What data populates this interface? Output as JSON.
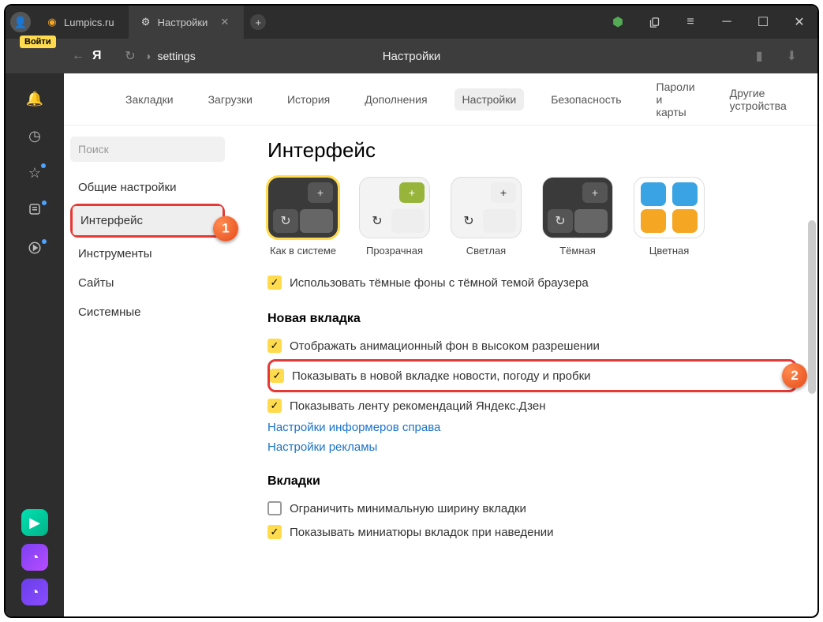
{
  "titlebar": {
    "login_badge": "Войти",
    "tabs": [
      {
        "label": "Lumpics.ru"
      },
      {
        "label": "Настройки"
      }
    ]
  },
  "addressbar": {
    "url_text": "settings",
    "center_title": "Настройки"
  },
  "topnav": {
    "items": [
      "Закладки",
      "Загрузки",
      "История",
      "Дополнения",
      "Настройки",
      "Безопасность",
      "Пароли и карты",
      "Другие устройства"
    ],
    "active_index": 4
  },
  "sidenav": {
    "search_placeholder": "Поиск",
    "items": [
      "Общие настройки",
      "Интерфейс",
      "Инструменты",
      "Сайты",
      "Системные"
    ],
    "active_index": 1
  },
  "settings": {
    "heading": "Интерфейс",
    "themes": [
      {
        "label": "Как в системе"
      },
      {
        "label": "Прозрачная"
      },
      {
        "label": "Светлая"
      },
      {
        "label": "Тёмная"
      },
      {
        "label": "Цветная"
      }
    ],
    "dark_bg_label": "Использовать тёмные фоны с тёмной темой браузера",
    "new_tab_heading": "Новая вкладка",
    "new_tab_checks": [
      {
        "checked": true,
        "label": "Отображать анимационный фон в высоком разрешении"
      },
      {
        "checked": true,
        "label": "Показывать в новой вкладке новости, погоду и пробки"
      },
      {
        "checked": true,
        "label": "Показывать ленту рекомендаций Яндекс.Дзен"
      }
    ],
    "links": [
      "Настройки информеров справа",
      "Настройки рекламы"
    ],
    "tabs_heading": "Вкладки",
    "tabs_checks": [
      {
        "checked": false,
        "label": "Ограничить минимальную ширину вкладки"
      },
      {
        "checked": true,
        "label": "Показывать миниатюры вкладок при наведении"
      }
    ]
  },
  "callouts": {
    "one": "1",
    "two": "2"
  }
}
